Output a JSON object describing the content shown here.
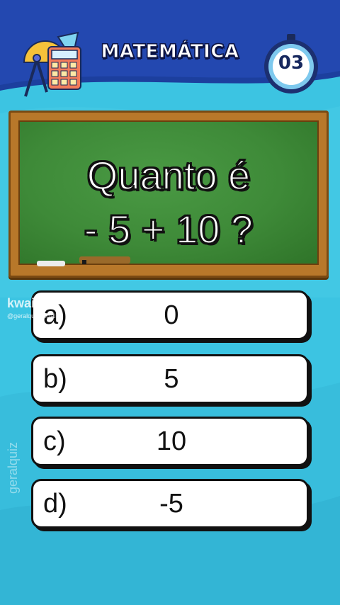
{
  "header": {
    "title": "MATEMÁTICA",
    "timer_value": "03",
    "icon": "math-tools-icon",
    "timer_icon": "stopwatch-icon"
  },
  "question": {
    "line1": "Quanto é",
    "line2": "- 5 + 10 ?"
  },
  "options": [
    {
      "letter": "a)",
      "value": "0"
    },
    {
      "letter": "b)",
      "value": "5"
    },
    {
      "letter": "c)",
      "value": "10"
    },
    {
      "letter": "d)",
      "value": "-5"
    }
  ],
  "watermark": {
    "logo": "kwai",
    "handle": "@geralquizoficial",
    "side": "geralquiz"
  },
  "colors": {
    "background": "#3fc6e3",
    "header": "#1c3f9e",
    "board": "#3e8a38",
    "frame": "#b8782a",
    "option_bg": "#ffffff"
  }
}
